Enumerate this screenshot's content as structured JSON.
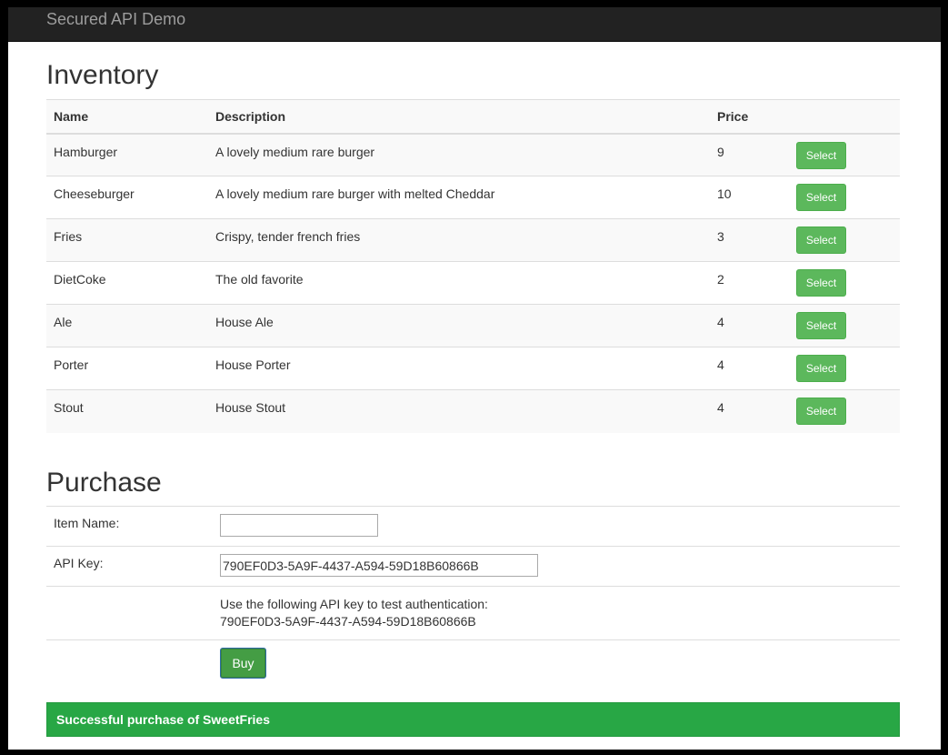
{
  "navbar": {
    "brand": "Secured API Demo"
  },
  "inventory": {
    "title": "Inventory",
    "columns": [
      "Name",
      "Description",
      "Price"
    ],
    "rows": [
      {
        "name": "Hamburger",
        "description": "A lovely medium rare burger",
        "price": "9",
        "action": "Select"
      },
      {
        "name": "Cheeseburger",
        "description": "A lovely medium rare burger with melted Cheddar",
        "price": "10",
        "action": "Select"
      },
      {
        "name": "Fries",
        "description": "Crispy, tender french fries",
        "price": "3",
        "action": "Select"
      },
      {
        "name": "DietCoke",
        "description": "The old favorite",
        "price": "2",
        "action": "Select"
      },
      {
        "name": "Ale",
        "description": "House Ale",
        "price": "4",
        "action": "Select"
      },
      {
        "name": "Porter",
        "description": "House Porter",
        "price": "4",
        "action": "Select"
      },
      {
        "name": "Stout",
        "description": "House Stout",
        "price": "4",
        "action": "Select"
      }
    ]
  },
  "purchase": {
    "title": "Purchase",
    "item_name_label": "Item Name:",
    "item_name_value": "",
    "api_key_label": "API Key:",
    "api_key_value": "790EF0D3-5A9F-4437-A594-59D18B60866B",
    "note_line1": "Use the following API key to test authentication:",
    "note_line2": "790EF0D3-5A9F-4437-A594-59D18B60866B",
    "buy_label": "Buy"
  },
  "alert": {
    "message": "Successful purchase of SweetFries"
  },
  "colors": {
    "navbar": "#222222",
    "success": "#5cb85c",
    "alert": "#28a745"
  }
}
